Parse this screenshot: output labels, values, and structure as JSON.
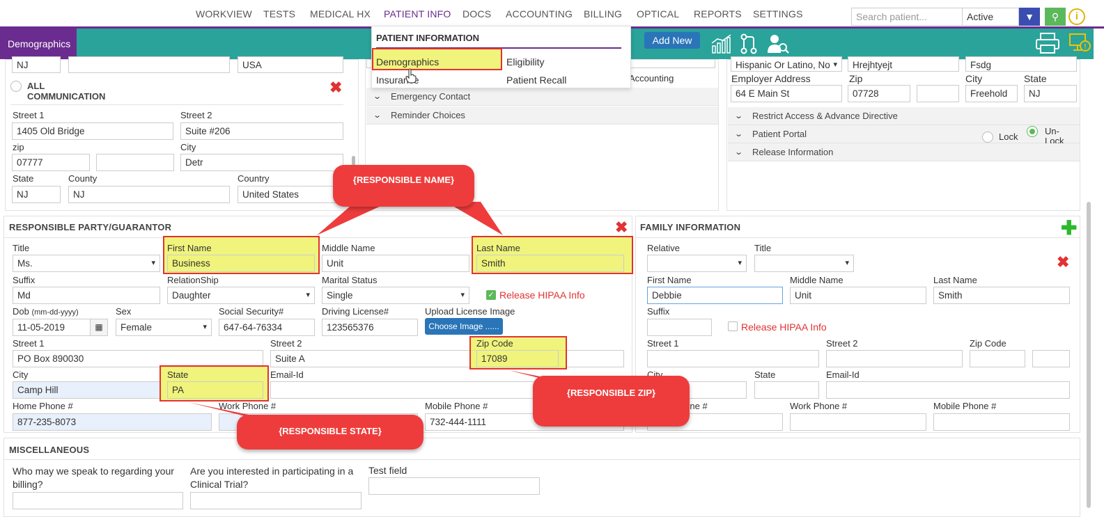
{
  "nav": {
    "items": [
      "WORKVIEW",
      "TESTS",
      "MEDICAL HX",
      "PATIENT INFO",
      "DOCS",
      "ACCOUNTING",
      "BILLING",
      "OPTICAL",
      "REPORTS",
      "SETTINGS"
    ],
    "search_placeholder": "Search patient...",
    "status_value": "Active"
  },
  "subbar": {
    "tab": "Demographics",
    "add_new": "Add New"
  },
  "menu": {
    "heading": "PATIENT INFORMATION",
    "items": [
      "Demographics",
      "Eligibility",
      "Insurance",
      "Patient Recall"
    ]
  },
  "top_left": {
    "r0": [
      "NJ",
      "",
      "USA"
    ],
    "all_comm": "ALL COMMUNICATION",
    "street1_label": "Street 1",
    "street1": "1405 Old Bridge",
    "street2_label": "Street 2",
    "street2": "Suite #206",
    "zip_label": "zip",
    "zip": "07777",
    "zip_ext": "",
    "city_label": "City",
    "city": "Detr",
    "state_label": "State",
    "state": "NJ",
    "county_label": "County",
    "county": "NJ",
    "country_label": "Country",
    "country": "United States"
  },
  "top_mid": {
    "accounting": "Accounting",
    "emergency": "Emergency Contact",
    "reminder": "Reminder Choices"
  },
  "top_right": {
    "r0": [
      "Hispanic Or Latino, No",
      "Hrejhtyejt",
      "Fsdg"
    ],
    "employer_label": "Employer Address",
    "employer": "64 E Main St",
    "zip_label": "Zip",
    "zip": "07728",
    "zip_ext": "",
    "city_label": "City",
    "city": "Freehold",
    "state_label": "State",
    "state": "NJ",
    "restrict": "Restrict Access & Advance Directive",
    "portal": "Patient Portal",
    "lock": "Lock",
    "unlock": "Un-Lock",
    "release": "Release Information"
  },
  "responsible": {
    "heading": "RESPONSIBLE PARTY/GUARANTOR",
    "title_label": "Title",
    "title": "Ms.",
    "first_label": "First Name",
    "first": "Business",
    "middle_label": "Middle Name",
    "middle": "Unit",
    "last_label": "Last Name",
    "last": "Smith",
    "suffix_label": "Suffix",
    "suffix": "Md",
    "relation_label": "RelationShip",
    "relation": "Daughter",
    "marital_label": "Marital Status",
    "marital": "Single",
    "hipaa": "Release HIPAA Info",
    "dob_label": "Dob",
    "dob_hint": "(mm-dd-yyyy)",
    "dob": "11-05-2019",
    "sex_label": "Sex",
    "sex": "Female",
    "ssn_label": "Social Security#",
    "ssn": "647-64-76334",
    "dl_label": "Driving License#",
    "dl": "123565376",
    "upload_label": "Upload License Image",
    "choose": "Choose Image ......",
    "street1_label": "Street 1",
    "street1": "PO Box 890030",
    "street2_label": "Street 2",
    "street2": "Suite A",
    "zip_label": "Zip Code",
    "zip": "17089",
    "city_label": "City",
    "city": "Camp Hill",
    "state_label": "State",
    "state": "PA",
    "email_label": "Email-Id",
    "email": "",
    "home_label": "Home Phone #",
    "home": "877-235-8073",
    "work_label": "Work Phone #",
    "work": "",
    "mobile_label": "Mobile Phone #",
    "mobile": "732-444-1111"
  },
  "family": {
    "heading": "FAMILY INFORMATION",
    "relative_label": "Relative",
    "title_label": "Title",
    "first_label": "First Name",
    "first": "Debbie",
    "middle_label": "Middle Name",
    "middle": "Unit",
    "last_label": "Last Name",
    "last": "Smith",
    "suffix_label": "Suffix",
    "hipaa": "Release HIPAA Info",
    "street1_label": "Street 1",
    "street2_label": "Street 2",
    "zip_label": "Zip Code",
    "city_label": "City",
    "state_label": "State",
    "email_label": "Email-Id",
    "home_label": "Home Phone #",
    "work_label": "Work Phone #",
    "mobile_label": "Mobile Phone #"
  },
  "misc": {
    "heading": "MISCELLANEOUS",
    "q1": "Who may we speak to regarding your billing?",
    "q2": "Are you interested in participating in a Clinical Trial?",
    "q3": "Test field"
  },
  "callouts": {
    "name": "{RESPONSIBLE NAME}",
    "zip": "{RESPONSIBLE ZIP}",
    "state": "{RESPONSIBLE STATE}"
  },
  "colors": {
    "purple": "#6a2c8f",
    "teal": "#2aa39a",
    "red": "#e23232",
    "highlight": "#ebf050"
  }
}
